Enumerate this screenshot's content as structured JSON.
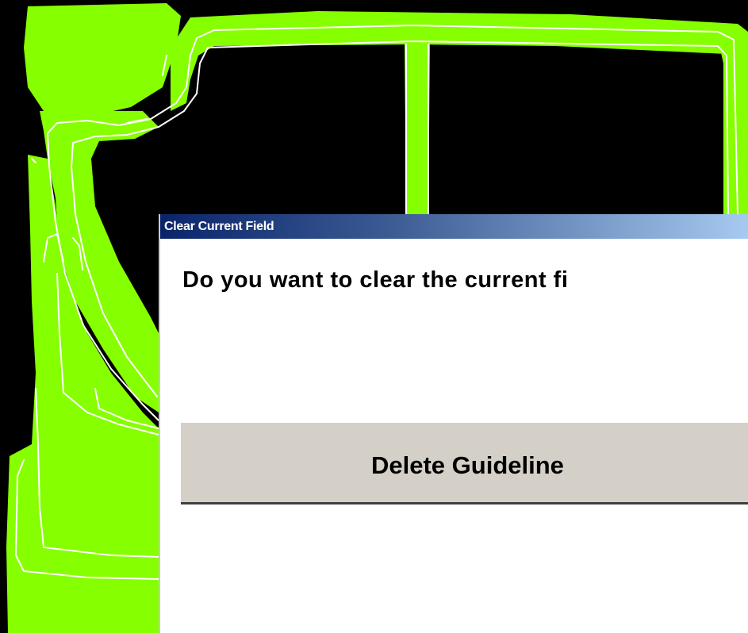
{
  "dialog": {
    "title": "Clear Current Field",
    "message": "Do you want to clear the current fi",
    "delete_button_label": "Delete Guideline"
  },
  "colors": {
    "field_fill": "#86ff00",
    "field_outline": "#ffffff",
    "background": "#000000",
    "button_face": "#d4d0c8",
    "titlebar_start": "#0a246a",
    "titlebar_end": "#a6caf0"
  }
}
